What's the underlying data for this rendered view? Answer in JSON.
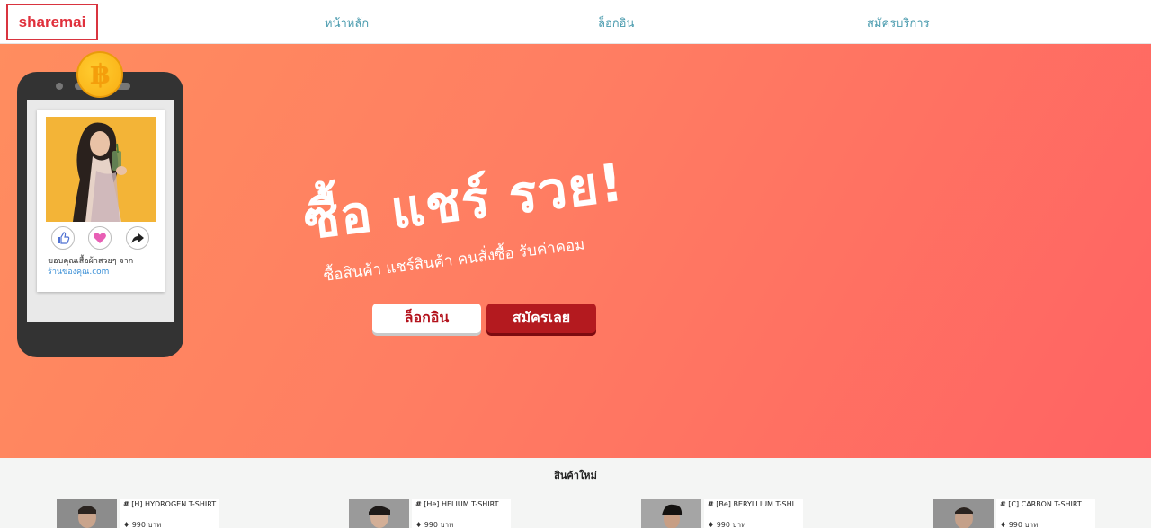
{
  "navbar": {
    "brand": "sharemai",
    "links": [
      {
        "label": "หน้าหลัก"
      },
      {
        "label": "ล็อกอิน"
      },
      {
        "label": "สมัครบริการ"
      }
    ]
  },
  "hero": {
    "coin_symbol": "฿",
    "post": {
      "caption": "ขอบคุณเสื้อผ้าสวยๆ จาก",
      "shop_link": "ร้านของคุณ.com",
      "actions": [
        "thumbs-up-icon",
        "heart-icon",
        "share-arrow-icon"
      ]
    },
    "title": "ซื้อ แชร์ รวย!",
    "subtitle": "ซื้อสินค้า แชร์สินค้า คนสั่งซื้อ รับค่าคอม",
    "login_button": "ล็อกอิน",
    "register_button": "สมัครเลย",
    "colors": {
      "gradient_start": "#ff8d5f",
      "gradient_end": "#ff6363",
      "register_button": "#b41a1f"
    }
  },
  "new_products": {
    "title": "สินค้าใหม่",
    "items": [
      {
        "name": "[H] HYDROGEN T-SHIRT",
        "price": "990 บาท"
      },
      {
        "name": "[He] HELIUM T-SHIRT",
        "price": "990 บาท"
      },
      {
        "name": "[Be] BERYLLIUM T-SHI",
        "price": "990 บาท"
      },
      {
        "name": "[C] CARBON T-SHIRT",
        "price": "990 บาท"
      }
    ]
  }
}
